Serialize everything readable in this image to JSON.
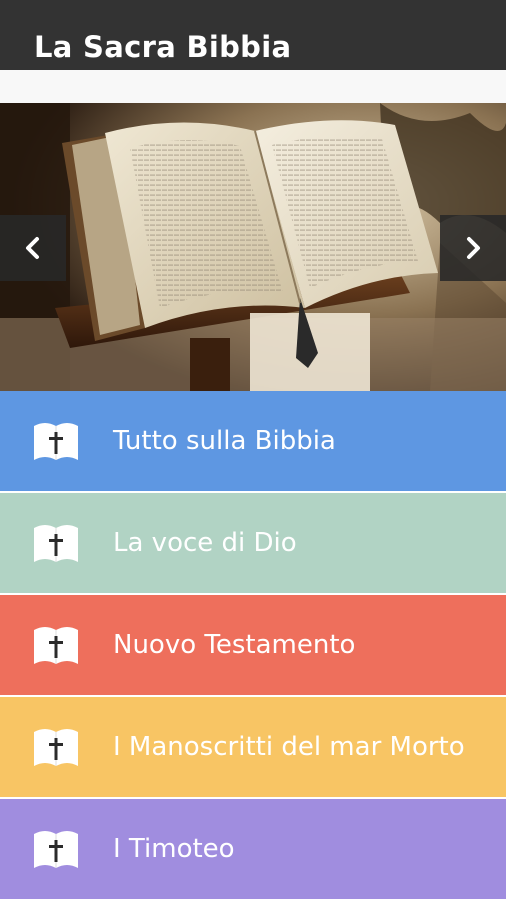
{
  "app": {
    "title": "La Sacra Bibbia",
    "bar_color": "#333333"
  },
  "carousel": {
    "image": "open-bible-on-lectern",
    "prev_icon": "chevron-left-icon",
    "next_icon": "chevron-right-icon"
  },
  "menu": {
    "items": [
      {
        "label": "Tutto sulla Bibbia",
        "color": "#5e97e2",
        "icon": "bible-cross-icon"
      },
      {
        "label": "La voce di Dio",
        "color": "#b1d3c4",
        "icon": "bible-cross-icon"
      },
      {
        "label": "Nuovo Testamento",
        "color": "#ee6f5c",
        "icon": "bible-cross-icon"
      },
      {
        "label": "I Manoscritti del mar Morto",
        "color": "#f8c564",
        "icon": "bible-cross-icon"
      },
      {
        "label": "I Timoteo",
        "color": "#a08ddf",
        "icon": "bible-cross-icon"
      }
    ]
  }
}
